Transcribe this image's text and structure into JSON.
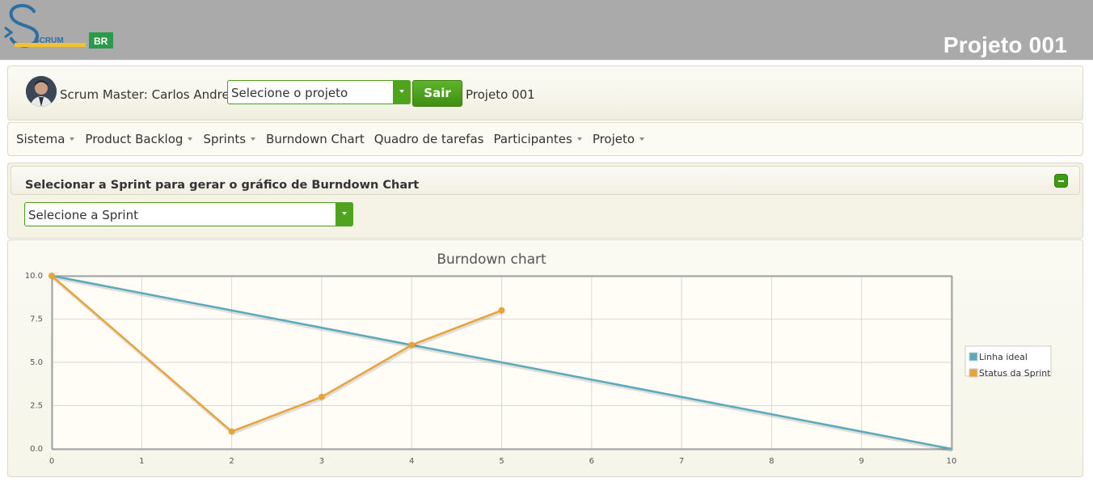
{
  "header": {
    "logo_text": "SCRUM",
    "logo_badge": "BR",
    "project_title": "Projeto 001"
  },
  "userbar": {
    "scrum_master": "Scrum Master: Carlos Andrey",
    "project_select_placeholder": "Selecione o projeto",
    "exit_label": "Sair",
    "current_project": "Projeto 001"
  },
  "menu": {
    "items": [
      {
        "label": "Sistema",
        "dropdown": true
      },
      {
        "label": "Product Backlog",
        "dropdown": true
      },
      {
        "label": "Sprints",
        "dropdown": true
      },
      {
        "label": "Burndown Chart",
        "dropdown": false
      },
      {
        "label": "Quadro de tarefas",
        "dropdown": false
      },
      {
        "label": "Participantes",
        "dropdown": true
      },
      {
        "label": "Projeto",
        "dropdown": true
      }
    ]
  },
  "sprint_panel": {
    "title": "Selecionar a Sprint para gerar o gráfico de Burndown Chart",
    "select_placeholder": "Selecione a Sprint"
  },
  "colors": {
    "accent_green": "#4ea41d",
    "ideal_line": "#5ba9bd",
    "sprint_line": "#e8a33d"
  },
  "chart_data": {
    "type": "line",
    "title": "Burndown chart",
    "xlabel": "",
    "ylabel": "",
    "xlim": [
      0,
      10
    ],
    "ylim": [
      0,
      10
    ],
    "x_ticks": [
      "0",
      "1",
      "2",
      "3",
      "4",
      "5",
      "6",
      "7",
      "8",
      "9",
      "10"
    ],
    "y_ticks": [
      "0.0",
      "2.5",
      "5.0",
      "7.5",
      "10.0"
    ],
    "grid": true,
    "legend_position": "right",
    "series": [
      {
        "name": "Linha ideal",
        "color": "#5ba9bd",
        "points": [
          [
            0,
            10
          ],
          [
            10,
            0
          ]
        ],
        "markers": false
      },
      {
        "name": "Status da Sprint",
        "color": "#e8a33d",
        "points": [
          [
            0,
            10
          ],
          [
            2,
            1
          ],
          [
            3,
            3
          ],
          [
            4,
            6
          ],
          [
            5,
            8
          ]
        ],
        "markers": true
      }
    ]
  }
}
